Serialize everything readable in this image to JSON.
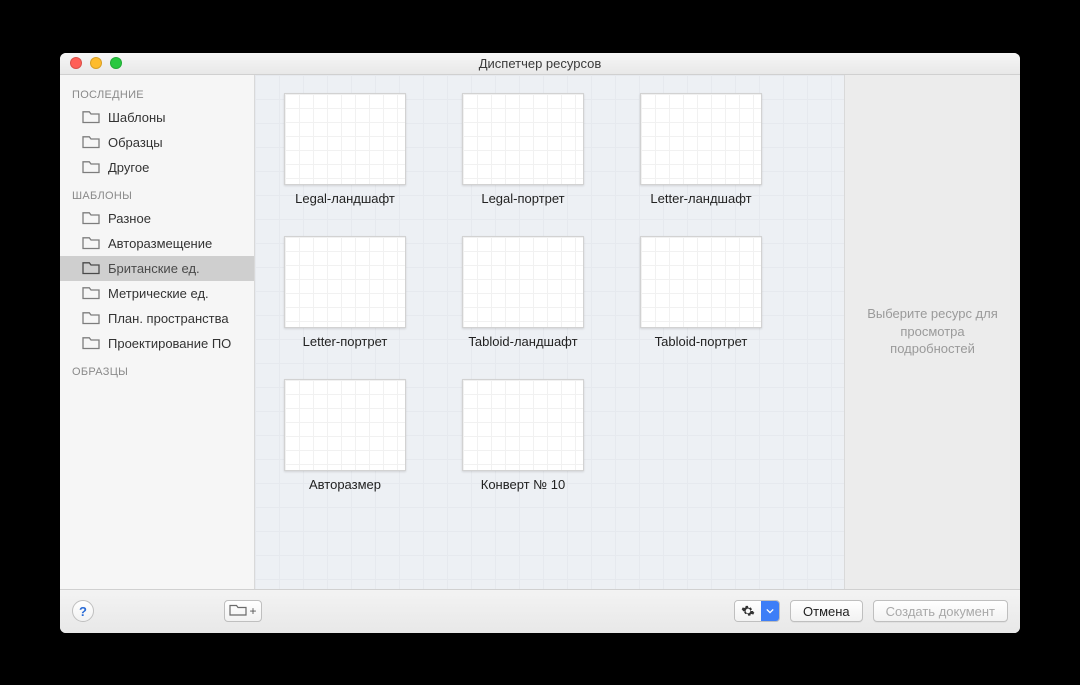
{
  "window": {
    "title": "Диспетчер ресурсов"
  },
  "sidebar": {
    "sections": [
      {
        "header": "ПОСЛЕДНИЕ",
        "items": [
          {
            "label": "Шаблоны",
            "selected": false
          },
          {
            "label": "Образцы",
            "selected": false
          },
          {
            "label": "Другое",
            "selected": false
          }
        ]
      },
      {
        "header": "ШАБЛОНЫ",
        "items": [
          {
            "label": "Разное",
            "selected": false
          },
          {
            "label": "Авторазмещение",
            "selected": false
          },
          {
            "label": "Британские ед.",
            "selected": true
          },
          {
            "label": "Метрические ед.",
            "selected": false
          },
          {
            "label": "План. пространства",
            "selected": false
          },
          {
            "label": "Проектирование ПО",
            "selected": false
          }
        ]
      },
      {
        "header": "ОБРАЗЦЫ",
        "items": []
      }
    ]
  },
  "templates": [
    {
      "label": "Legal-ландшафт"
    },
    {
      "label": "Legal-портрет"
    },
    {
      "label": "Letter-ландшафт"
    },
    {
      "label": "Letter-портрет"
    },
    {
      "label": "Tabloid-ландшафт"
    },
    {
      "label": "Tabloid-портрет"
    },
    {
      "label": "Авторазмер"
    },
    {
      "label": "Конверт № 10"
    }
  ],
  "details": {
    "placeholder": "Выберите ресурс для просмотра подробностей"
  },
  "footer": {
    "help": "?",
    "folder_add": "+",
    "cancel": "Отмена",
    "create": "Создать документ"
  },
  "icons": {
    "folder": "folder-icon",
    "gear": "gear-icon",
    "chevron_down": "chevron-down-icon"
  }
}
